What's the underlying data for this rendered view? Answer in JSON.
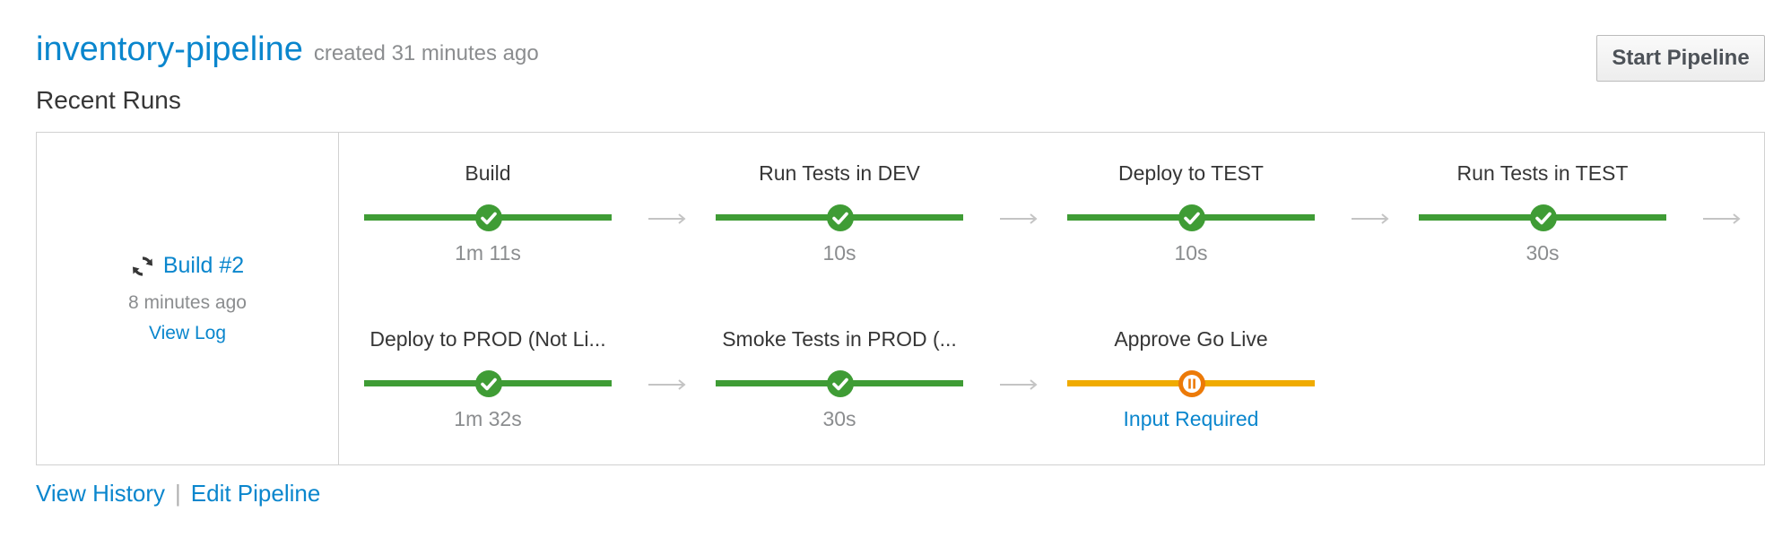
{
  "header": {
    "pipeline_name": "inventory-pipeline",
    "created": "created 31 minutes ago",
    "start_button": "Start Pipeline"
  },
  "section_title": "Recent Runs",
  "run": {
    "build_label": "Build #2",
    "time_ago": "8 minutes ago",
    "view_log": "View Log"
  },
  "stages": [
    {
      "name": "Build",
      "duration": "1m 11s",
      "status": "success"
    },
    {
      "name": "Run Tests in DEV",
      "duration": "10s",
      "status": "success"
    },
    {
      "name": "Deploy to TEST",
      "duration": "10s",
      "status": "success"
    },
    {
      "name": "Run Tests in TEST",
      "duration": "30s",
      "status": "success"
    },
    {
      "name": "Deploy to PROD (Not Li...",
      "duration": "1m 32s",
      "status": "success"
    },
    {
      "name": "Smoke Tests in PROD (...",
      "duration": "30s",
      "status": "success"
    },
    {
      "name": "Approve Go Live",
      "duration": "Input Required",
      "status": "paused"
    }
  ],
  "footer": {
    "view_history": "View History",
    "separator": "|",
    "edit_pipeline": "Edit Pipeline"
  },
  "colors": {
    "link": "#0a86cd",
    "success": "#3f9c35",
    "paused": "#ec7a08",
    "paused_bar": "#f0ab00"
  },
  "icons": {
    "build": "sync-icon",
    "success": "check-circle-icon",
    "paused": "pause-circle-icon",
    "connector": "arrow-right-icon"
  }
}
